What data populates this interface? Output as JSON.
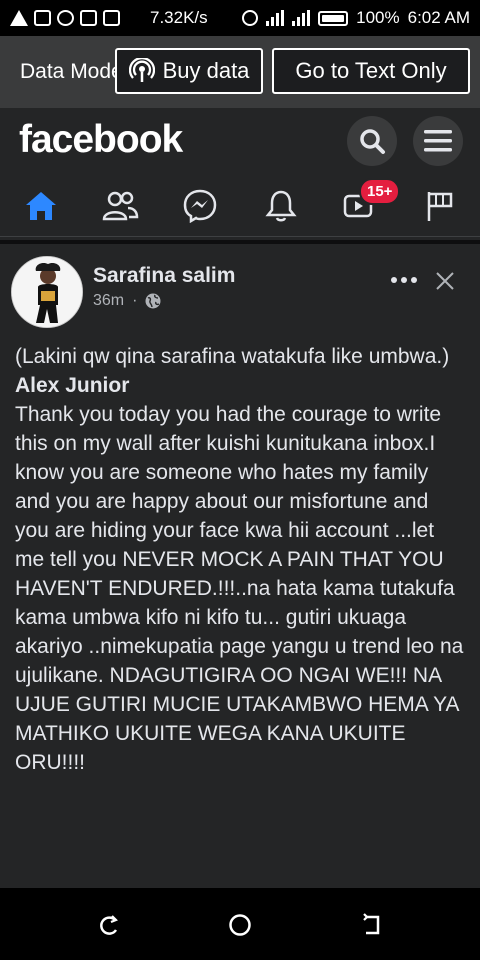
{
  "status_bar": {
    "speed": "7.32K/s",
    "battery": "100%",
    "time": "6:02 AM"
  },
  "data_bar": {
    "label": "Data Mode",
    "buy_data": "Buy data",
    "text_only": "Go to Text Only"
  },
  "header": {
    "logo": "facebook",
    "notification_badge": "15+"
  },
  "post": {
    "author": "Sarafina salim",
    "time": "36m",
    "separator": "·",
    "body": {
      "line1": "(Lakini qw qina sarafina watakufa like umbwa.)",
      "line2": "Alex Junior",
      "line3": "Thank you  today you had the courage to write this on my wall after kuishi kunitukana inbox.I know you are someone who hates  my family and you are happy about our misfortune and you are hiding your  face kwa hii account ...let me tell you NEVER MOCK A PAIN THAT YOU HAVEN'T ENDURED.!!!..na hata kama tutakufa kama umbwa kifo ni kifo tu... gutiri ukuaga akariyo ..nimekupatia page yangu u trend leo na ujulikane. NDAGUTIGIRA OO NGAI WE!!! NA UJUE GUTIRI MUCIE UTAKAMBWO HEMA YA MATHIKO UKUITE WEGA KANA UKUITE ORU!!!!"
    }
  },
  "colors": {
    "accent": "#2d88ff",
    "badge": "#e41e3f",
    "surface": "#242526"
  }
}
